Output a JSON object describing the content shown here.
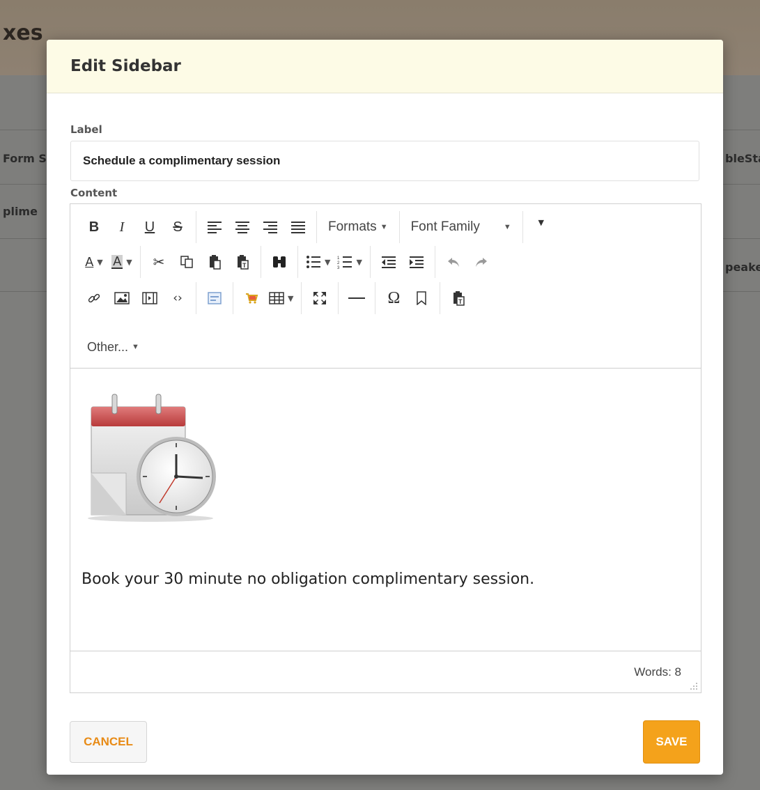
{
  "background": {
    "page_title": "xes",
    "row1_left": "Form S",
    "row1_right": "bleSta",
    "row2_left": "plime",
    "row3_right": "peake"
  },
  "modal": {
    "title": "Edit Sidebar",
    "label_field": {
      "label": "Label",
      "value": "Schedule a complimentary session"
    },
    "content_field": {
      "label": "Content"
    },
    "toolbar": {
      "formats_label": "Formats",
      "font_family_label": "Font Family",
      "other_label": "Other...",
      "forecolor_letter": "A",
      "backcolor_letter": "A",
      "icons": {
        "bold": "B",
        "italic": "I",
        "underline": "U",
        "strikethrough": "S",
        "cut": "✂",
        "omega": "Ω",
        "binoculars": "🔭"
      }
    },
    "content": {
      "image_alt": "calendar-clock",
      "body_text": "Book your 30 minute no obligation complimentary session."
    },
    "status": {
      "word_count": "Words: 8"
    },
    "buttons": {
      "cancel": "CANCEL",
      "save": "SAVE"
    }
  },
  "colors": {
    "accent_orange": "#f4a21b",
    "cancel_text": "#e88b16",
    "modal_header_bg": "#fdfbe6"
  }
}
